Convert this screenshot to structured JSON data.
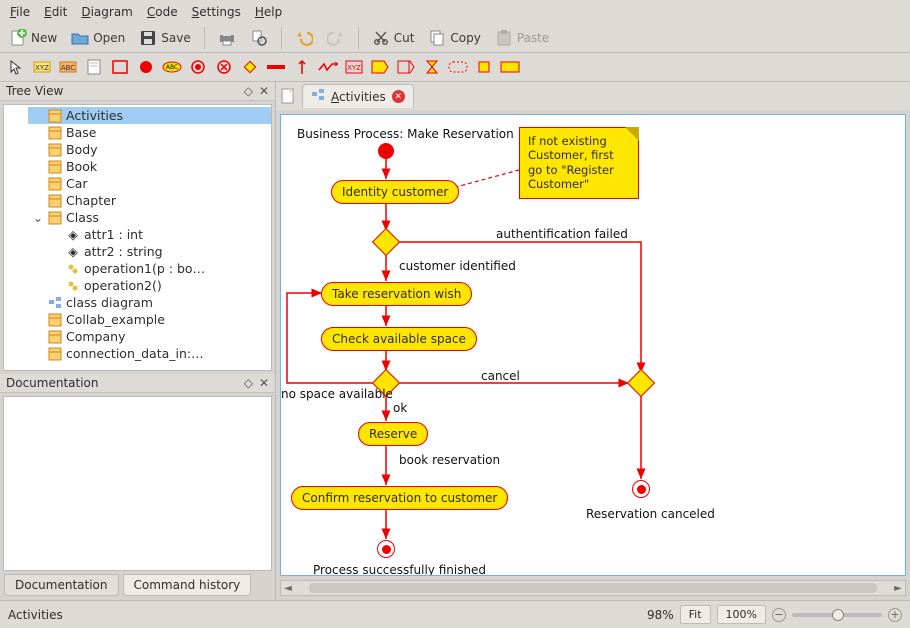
{
  "menu": {
    "file": "File",
    "edit": "Edit",
    "diagram": "Diagram",
    "code": "Code",
    "settings": "Settings",
    "help": "Help"
  },
  "toolbar": {
    "new": "New",
    "open": "Open",
    "save": "Save",
    "cut": "Cut",
    "copy": "Copy",
    "paste": "Paste"
  },
  "panels": {
    "tree_title": "Tree View",
    "doc_title": "Documentation"
  },
  "doc_tabs": {
    "documentation": "Documentation",
    "command_history": "Command history"
  },
  "tree": {
    "items": [
      {
        "label": "Activities",
        "selected": true
      },
      {
        "label": "Base"
      },
      {
        "label": "Body"
      },
      {
        "label": "Book"
      },
      {
        "label": "Car"
      },
      {
        "label": "Chapter"
      }
    ],
    "class_label": "Class",
    "class_members": [
      {
        "label": "attr1 : int",
        "kind": "attr"
      },
      {
        "label": "attr2 : string",
        "kind": "attr"
      },
      {
        "label": "operation1(p : bo…",
        "kind": "op"
      },
      {
        "label": "operation2()",
        "kind": "op"
      }
    ],
    "after": [
      {
        "label": "class diagram",
        "kind": "diagram"
      },
      {
        "label": "Collab_example"
      },
      {
        "label": "Company"
      },
      {
        "label": "connection_data_in:…"
      }
    ]
  },
  "tab": {
    "label": "Activities"
  },
  "diagram": {
    "title": "Business Process: Make Reservation",
    "note": "If not existing Customer, first go to \"Register Customer\"",
    "n_identity": "Identity customer",
    "n_take": "Take reservation wish",
    "n_check": "Check available space",
    "n_reserve": "Reserve",
    "n_confirm": "Confirm reservation to customer",
    "l_authfail": "authentification failed",
    "l_custid": "customer identified",
    "l_cancel": "cancel",
    "l_nospace": "no space available",
    "l_ok": "ok",
    "l_book": "book reservation",
    "l_success": "Process successfully finished",
    "l_canceled": "Reservation canceled"
  },
  "footer": {
    "status": "Activities",
    "zoom_pct": "98%",
    "fit": "Fit",
    "hundred": "100%"
  }
}
